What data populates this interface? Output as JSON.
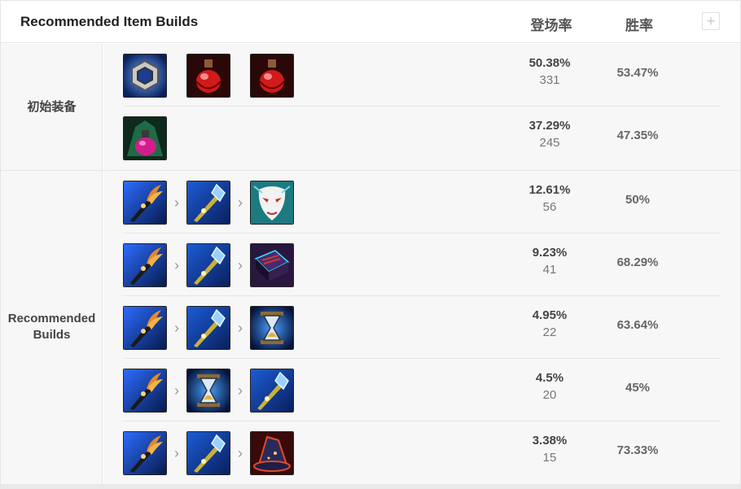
{
  "header": {
    "title": "Recommended Item Builds",
    "col_pick": "登场率",
    "col_win": "胜率",
    "add_icon": "+"
  },
  "sections": [
    {
      "label": "初始装备",
      "rows": [
        {
          "items": [
            "ring-item-icon",
            "health-potion-item-icon",
            "health-potion-item-icon"
          ],
          "pick_rate": "50.38%",
          "count": "331",
          "win_rate": "53.47%"
        },
        {
          "items": [
            "corrupting-potion-item-icon"
          ],
          "pick_rate": "37.29%",
          "count": "245",
          "win_rate": "47.35%"
        }
      ]
    },
    {
      "label": "Recommended\nBuilds",
      "rows": [
        {
          "items": [
            "claw-weapon-item-icon",
            "crystal-scepter-item-icon",
            "mask-item-icon"
          ],
          "pick_rate": "12.61%",
          "count": "56",
          "win_rate": "50%"
        },
        {
          "items": [
            "claw-weapon-item-icon",
            "crystal-scepter-item-icon",
            "tome-item-icon"
          ],
          "pick_rate": "9.23%",
          "count": "41",
          "win_rate": "68.29%"
        },
        {
          "items": [
            "claw-weapon-item-icon",
            "crystal-scepter-item-icon",
            "hourglass-item-icon"
          ],
          "pick_rate": "4.95%",
          "count": "22",
          "win_rate": "63.64%"
        },
        {
          "items": [
            "claw-weapon-item-icon",
            "hourglass-item-icon",
            "crystal-scepter-item-icon"
          ],
          "pick_rate": "4.5%",
          "count": "20",
          "win_rate": "45%"
        },
        {
          "items": [
            "claw-weapon-item-icon",
            "crystal-scepter-item-icon",
            "wizard-hat-item-icon"
          ],
          "pick_rate": "3.38%",
          "count": "15",
          "win_rate": "73.33%"
        }
      ]
    }
  ],
  "arrow_glyph": "›"
}
